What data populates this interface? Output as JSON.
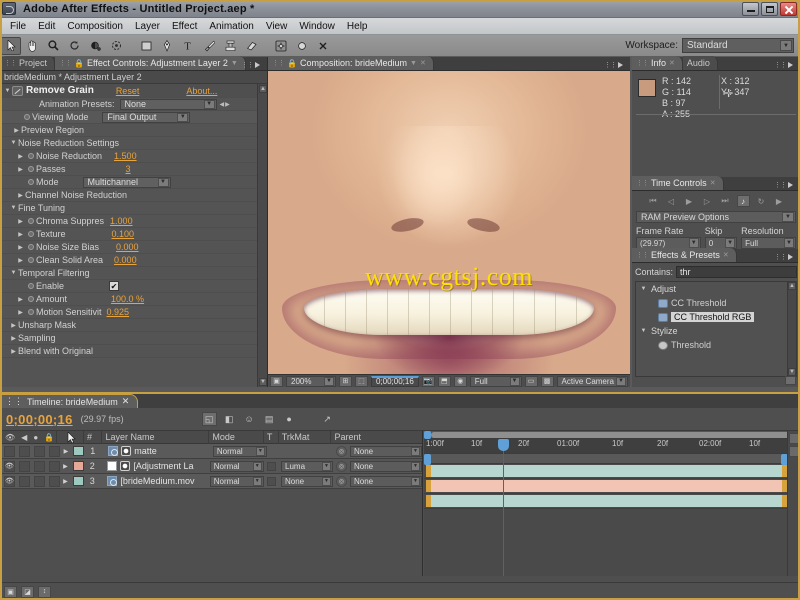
{
  "titlebar": {
    "title": "Adobe After Effects - Untitled Project.aep *",
    "app_icon": "ae-logo-icon",
    "minimize": "minimize-icon",
    "maximize": "maximize-icon",
    "close": "close-icon"
  },
  "menubar": {
    "items": [
      "File",
      "Edit",
      "Composition",
      "Layer",
      "Effect",
      "Animation",
      "View",
      "Window",
      "Help"
    ]
  },
  "toolbar": {
    "tools": [
      {
        "name": "selection-tool",
        "glyph": "↖"
      },
      {
        "name": "hand-tool",
        "glyph": "✋"
      },
      {
        "name": "zoom-tool",
        "glyph": "⚲"
      },
      {
        "name": "rotation-tool",
        "glyph": "↻"
      },
      {
        "name": "pan-behind-tool",
        "glyph": "◑"
      },
      {
        "name": "mask-tool",
        "glyph": "⬚"
      },
      {
        "name": "shape-tool",
        "glyph": "■"
      },
      {
        "name": "pen-tool",
        "glyph": "✒"
      },
      {
        "name": "text-tool",
        "glyph": "T"
      },
      {
        "name": "brush-tool",
        "glyph": "╱"
      },
      {
        "name": "clone-stamp-tool",
        "glyph": "⚓"
      },
      {
        "name": "eraser-tool",
        "glyph": "▱"
      }
    ],
    "extra_tools": [
      {
        "name": "puppet-pin-tool",
        "glyph": "✣"
      },
      {
        "name": "puppet-overlap-tool",
        "glyph": "●"
      },
      {
        "name": "puppet-starch-tool",
        "glyph": "✕"
      }
    ],
    "workspace_label": "Workspace:",
    "workspace_value": "Standard"
  },
  "effect_controls": {
    "tabs": [
      {
        "label": "Project",
        "active": false
      },
      {
        "label": "Effect Controls: Adjustment Layer 2",
        "active": true
      }
    ],
    "breadcrumb": "brideMedium * Adjustment Layer 2",
    "effect_name": "Remove Grain",
    "reset_label": "Reset",
    "about_label": "About...",
    "animation_presets_label": "Animation Presets:",
    "animation_presets_value": "None",
    "properties": [
      {
        "name": "Viewing Mode",
        "type": "dropdown",
        "value": "Final Output",
        "indent": 1,
        "stopwatch": true
      },
      {
        "name": "Preview Region",
        "type": "group",
        "collapsed": true,
        "indent": 0
      },
      {
        "name": "Noise Reduction Settings",
        "type": "group",
        "collapsed": false,
        "indent": 0
      },
      {
        "name": "Noise Reduction",
        "type": "value",
        "value": "1.500",
        "indent": 1,
        "stopwatch": true,
        "twirl": true
      },
      {
        "name": "Passes",
        "type": "value",
        "value": "3",
        "indent": 1,
        "stopwatch": true,
        "twirl": true
      },
      {
        "name": "Mode",
        "type": "dropdown",
        "value": "Multichannel",
        "indent": 1,
        "stopwatch": true
      },
      {
        "name": "Channel Noise Reduction",
        "type": "group",
        "collapsed": true,
        "indent": 1
      },
      {
        "name": "Fine Tuning",
        "type": "group",
        "collapsed": false,
        "indent": 0
      },
      {
        "name": "Chroma Suppres",
        "type": "value",
        "value": "1.000",
        "indent": 1,
        "stopwatch": true,
        "twirl": true
      },
      {
        "name": "Texture",
        "type": "value",
        "value": "0.100",
        "indent": 1,
        "stopwatch": true,
        "twirl": true
      },
      {
        "name": "Noise Size Bias",
        "type": "value",
        "value": "0.000",
        "indent": 1,
        "stopwatch": true,
        "twirl": true
      },
      {
        "name": "Clean Solid Area",
        "type": "value",
        "value": "0.000",
        "indent": 1,
        "stopwatch": true,
        "twirl": true
      },
      {
        "name": "Temporal Filtering",
        "type": "group",
        "collapsed": false,
        "indent": 0
      },
      {
        "name": "Enable",
        "type": "checkbox",
        "value": "✔",
        "indent": 1,
        "stopwatch": true
      },
      {
        "name": "Amount",
        "type": "value",
        "value": "100.0 %",
        "indent": 1,
        "stopwatch": true,
        "twirl": true
      },
      {
        "name": "Motion Sensitivit",
        "type": "value",
        "value": "0.925",
        "indent": 1,
        "stopwatch": true,
        "twirl": true
      },
      {
        "name": "Unsharp Mask",
        "type": "group",
        "collapsed": true,
        "indent": 0
      },
      {
        "name": "Sampling",
        "type": "group",
        "collapsed": true,
        "indent": 0
      },
      {
        "name": "Blend with Original",
        "type": "group",
        "collapsed": true,
        "indent": 0
      }
    ]
  },
  "composition": {
    "tab_label": "Composition: brideMedium",
    "watermark": "www.cgtsj.com",
    "toolbar": {
      "zoom": "200%",
      "timecode": "0;00;00;16",
      "resolution": "Full",
      "view": "Active Camera"
    }
  },
  "info_panel": {
    "tabs": [
      {
        "label": "Info",
        "active": true
      },
      {
        "label": "Audio",
        "active": false
      }
    ],
    "swatch_color": "#c89a7e",
    "rgba": [
      "R : 142",
      "G : 114",
      "B : 97",
      "A : 255"
    ],
    "coords": [
      "X : 312",
      "Y : 347"
    ]
  },
  "time_controls": {
    "tab_label": "Time Controls",
    "buttons": [
      {
        "name": "first-frame-button",
        "glyph": "⏮"
      },
      {
        "name": "previous-frame-button",
        "glyph": "◁"
      },
      {
        "name": "play-button",
        "glyph": "▶"
      },
      {
        "name": "next-frame-button",
        "glyph": "▷"
      },
      {
        "name": "last-frame-button",
        "glyph": "⏭"
      },
      {
        "name": "audio-toggle-button",
        "glyph": "♪",
        "active": true
      },
      {
        "name": "loop-button",
        "glyph": "↻"
      },
      {
        "name": "ram-preview-button",
        "glyph": "▶"
      }
    ],
    "ram_preview_label": "RAM Preview Options",
    "frame_rate_label": "Frame Rate",
    "frame_rate_value": "(29.97)",
    "skip_label": "Skip",
    "skip_value": "0",
    "resolution_label": "Resolution",
    "resolution_value": "Full"
  },
  "effects_presets": {
    "tab_label": "Effects & Presets",
    "contains_label": "Contains:",
    "contains_value": "thr",
    "items": [
      {
        "label": "Adjust",
        "type": "group",
        "selected": false
      },
      {
        "label": "CC Threshold",
        "type": "effect",
        "selected": false
      },
      {
        "label": "CC Threshold RGB",
        "type": "effect",
        "selected": true
      },
      {
        "label": "Stylize",
        "type": "group",
        "selected": false
      },
      {
        "label": "Threshold",
        "type": "effect",
        "selected": false
      }
    ]
  },
  "timeline": {
    "tab_label": "Timeline: brideMedium",
    "current_time": "0;00;00;16",
    "fps": "(29.97 fps)",
    "toolbar_icons": [
      {
        "name": "toggle-switches-modes-button",
        "glyph": "◱",
        "active": true
      },
      {
        "name": "draft-3d-button",
        "glyph": "◧"
      },
      {
        "name": "hide-shy-layers-button",
        "glyph": "☺"
      },
      {
        "name": "frame-blending-button",
        "glyph": "▤"
      },
      {
        "name": "motion-blur-button",
        "glyph": "●"
      },
      {
        "name": "graph-editor-button",
        "glyph": "↗"
      }
    ],
    "columns": [
      "#",
      "Layer Name",
      "Mode",
      "T",
      "TrkMat",
      "Parent"
    ],
    "layers": [
      {
        "index": "1",
        "name": "matte",
        "mode": "Normal",
        "trkmat": "",
        "parent": "None",
        "label_color": "#9ec9bf",
        "bar_color": "#b6d6cf",
        "visible": false,
        "has_trkmat": false
      },
      {
        "index": "2",
        "name": "[Adjustment La",
        "mode": "Normal",
        "trkmat": "Luma",
        "parent": "None",
        "label_color": "#e8a898",
        "bar_color": "#f2c4b3",
        "visible": true,
        "has_trkmat": true
      },
      {
        "index": "3",
        "name": "[brideMedium.mov",
        "mode": "Normal",
        "trkmat": "None",
        "parent": "None",
        "label_color": "#9ec9bf",
        "bar_color": "#b6d6cf",
        "visible": true,
        "has_trkmat": true
      }
    ],
    "ruler_ticks": [
      "1:00f",
      "10f",
      "20f",
      "01:00f",
      "10f",
      "20f",
      "02:00f",
      "10f"
    ]
  },
  "colors": {
    "accent_orange": "#e8a33d",
    "panel_bg": "#4f4f4f",
    "highlight_blue": "#5fa0d8",
    "playhead_red": "#cc3333",
    "watermark_yellow": "#ffe000"
  }
}
